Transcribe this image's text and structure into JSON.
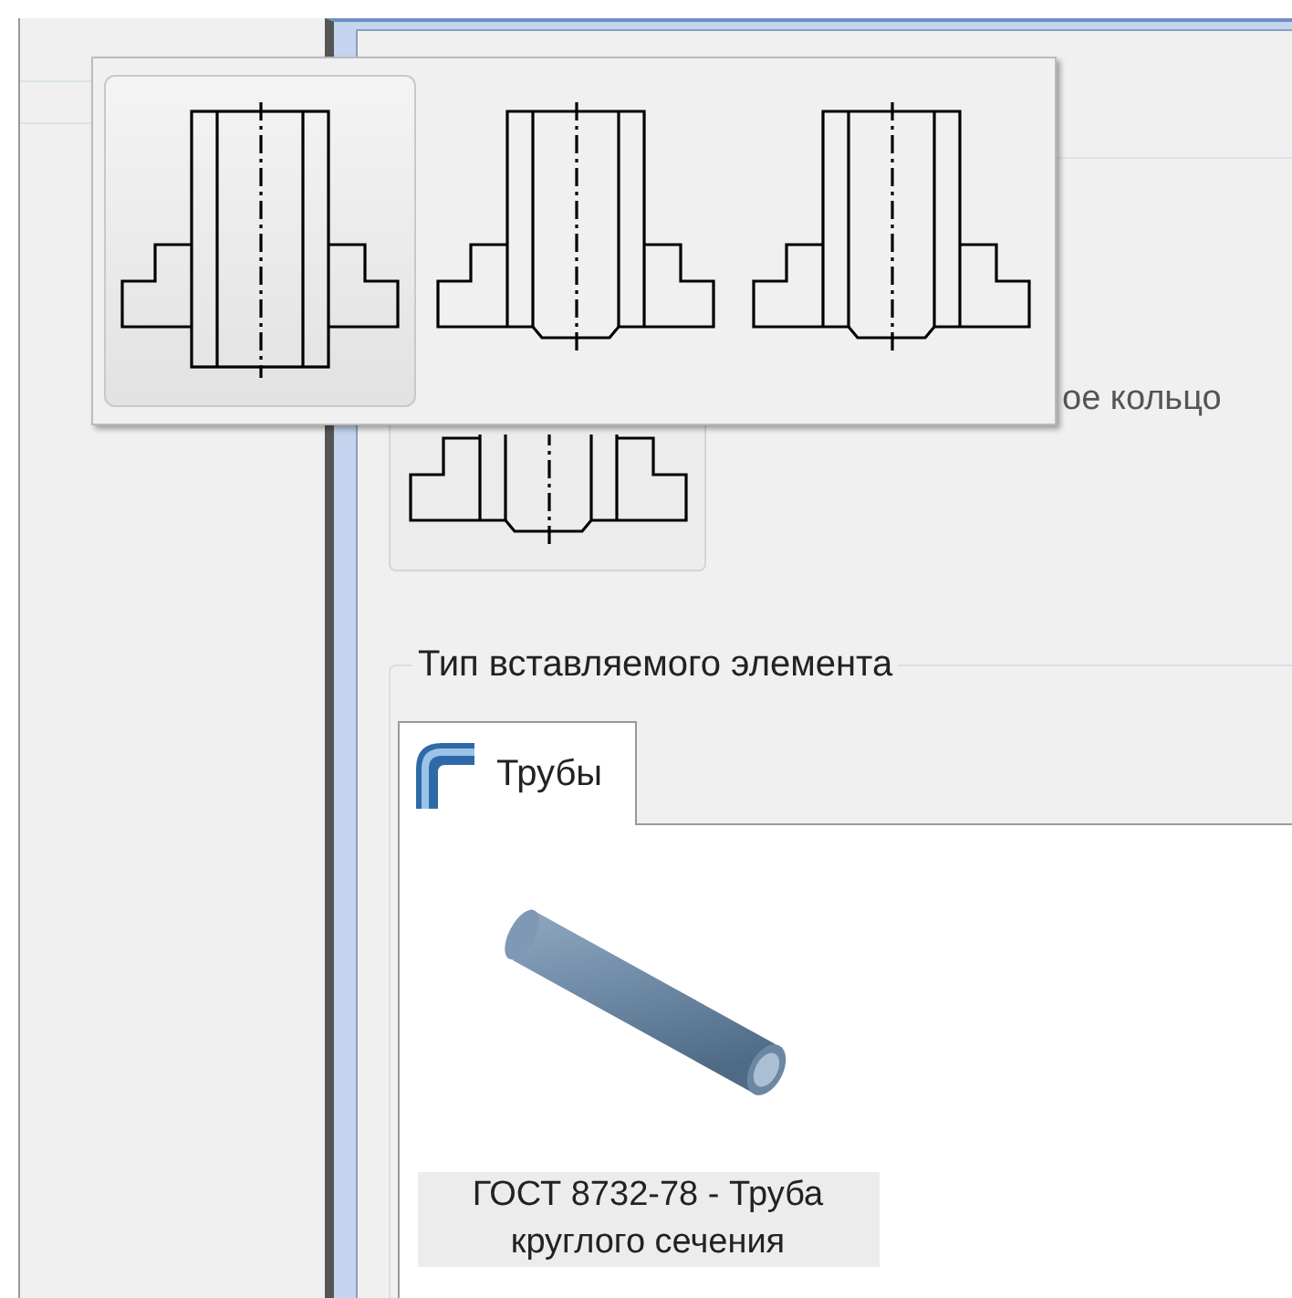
{
  "top_panel": {
    "partial_label": "ое кольцо",
    "button": {
      "kind": "chamfer"
    }
  },
  "popup": {
    "options": [
      {
        "kind": "straight",
        "selected": true
      },
      {
        "kind": "chamfer",
        "selected": false
      },
      {
        "kind": "chamfer",
        "selected": false
      }
    ]
  },
  "group": {
    "title": "Тип вставляемого элемента",
    "tabs": [
      {
        "label": "Трубы",
        "selected": true
      }
    ],
    "items": [
      {
        "caption": "ГОСТ 8732-78 - Труба круглого сечения",
        "selected": true
      }
    ]
  }
}
